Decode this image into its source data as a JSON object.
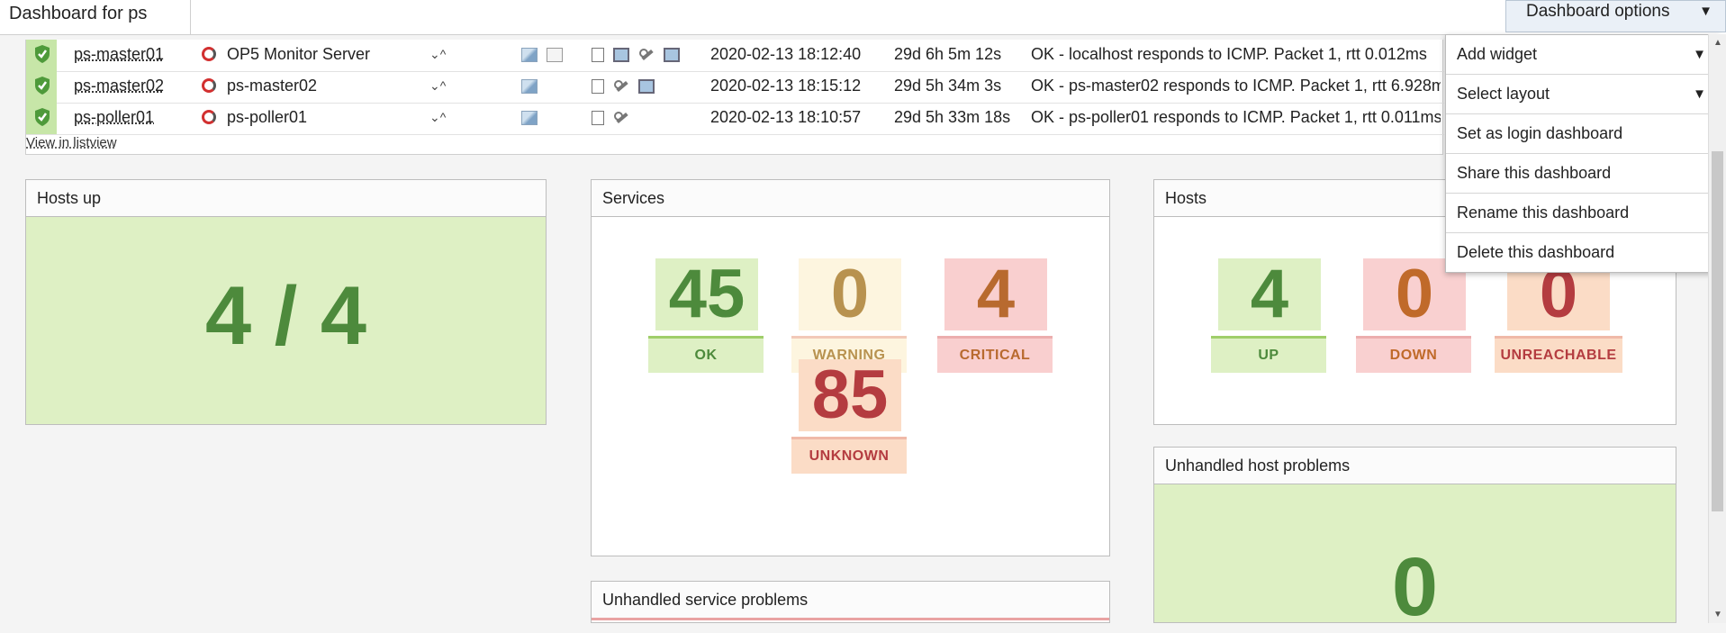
{
  "header": {
    "title": "Dashboard for ps",
    "options_label": "Dashboard options",
    "options_caret": "▼"
  },
  "hosts_table": {
    "rows": [
      {
        "name": "ps-master01",
        "alias": "OP5 Monitor Server",
        "arrows": "⌄^",
        "last_check": "2020-02-13 18:12:40",
        "duration": "29d 6h 5m 12s",
        "output": "OK - localhost responds to ICMP. Packet 1, rtt 0.012ms"
      },
      {
        "name": "ps-master02",
        "alias": "ps-master02",
        "arrows": "⌄^",
        "last_check": "2020-02-13 18:15:12",
        "duration": "29d 5h 34m 3s",
        "output": "OK - ps-master02 responds to ICMP. Packet 1, rtt 6.928ms"
      },
      {
        "name": "ps-poller01",
        "alias": "ps-poller01",
        "arrows": "⌄^",
        "last_check": "2020-02-13 18:10:57",
        "duration": "29d 5h 33m 18s",
        "output": "OK - ps-poller01 responds to ICMP. Packet 1, rtt 0.011ms"
      }
    ],
    "listview_link": "View in listview"
  },
  "widgets": {
    "hosts_up": {
      "title": "Hosts up",
      "value": "4 / 4"
    },
    "services": {
      "title": "Services",
      "ok": {
        "value": "45",
        "label": "OK"
      },
      "warning": {
        "value": "0",
        "label": "WARNING"
      },
      "critical": {
        "value": "4",
        "label": "CRITICAL"
      },
      "unknown": {
        "value": "85",
        "label": "UNKNOWN"
      }
    },
    "hosts": {
      "title": "Hosts",
      "up": {
        "value": "4",
        "label": "UP"
      },
      "down": {
        "value": "0",
        "label": "DOWN"
      },
      "unreachable": {
        "value": "0",
        "label": "UNREACHABLE"
      }
    },
    "unhandled_service": {
      "title": "Unhandled service problems"
    },
    "unhandled_host": {
      "title": "Unhandled host problems",
      "value": "0"
    }
  },
  "menu": {
    "items": [
      {
        "label": "Add widget",
        "caret": "▼"
      },
      {
        "label": "Select layout",
        "caret": "▼"
      },
      {
        "label": "Set as login dashboard"
      },
      {
        "label": "Share this dashboard"
      },
      {
        "label": "Rename this dashboard"
      },
      {
        "label": "Delete this dashboard"
      }
    ]
  },
  "colors": {
    "ok_green": "#4d8a3c",
    "ok_bg": "#def0c4",
    "warning_text": "#b8924f",
    "warning_bg": "#fdf5df",
    "critical_text": "#b86a2f",
    "critical_bg": "#f9cfcf",
    "unknown_text": "#b43c40",
    "unknown_bg": "#fbdcc6",
    "down_text": "#c06a2a",
    "down_bg": "#f9d0d0",
    "unreachable_text": "#b43c40",
    "unreachable_bg": "#fbdcc6"
  }
}
